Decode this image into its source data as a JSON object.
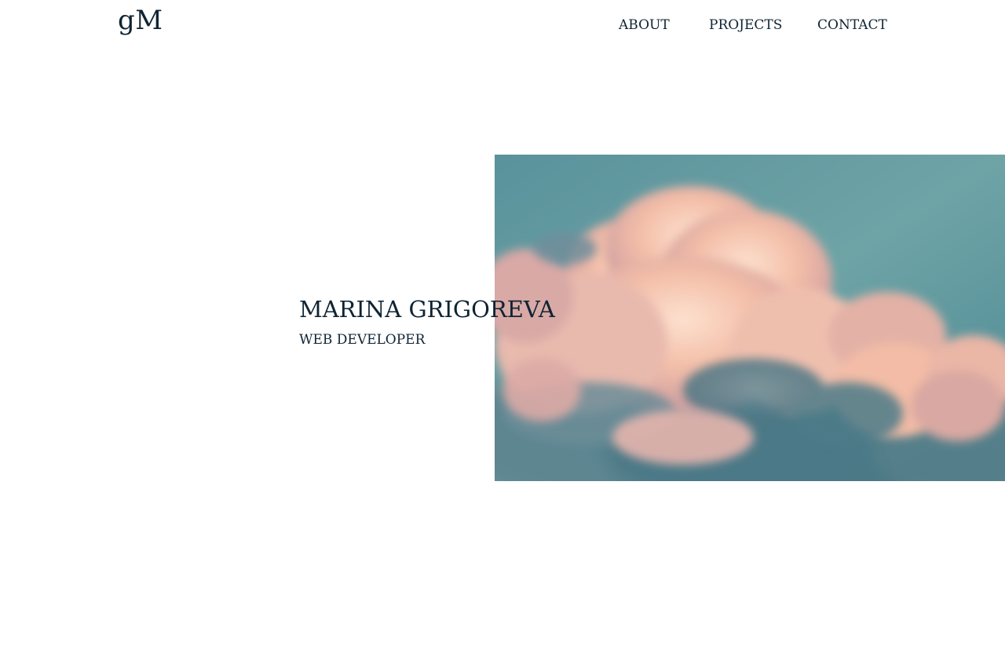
{
  "header": {
    "logo": "gM",
    "nav": [
      {
        "label": "ABOUT"
      },
      {
        "label": "PROJECTS"
      },
      {
        "label": "CONTACT"
      }
    ]
  },
  "hero": {
    "name": "MARINA GRIGOREVA",
    "role": "WEB DEVELOPER",
    "image": {
      "subject": "pink-tinted cumulus clouds against a teal sky"
    }
  },
  "colors": {
    "text": "#0f2433",
    "background": "#ffffff",
    "sky": "#5e96a0",
    "cloud_highlight": "#f5c2ad",
    "cloud_shadow": "#4d7d8a"
  }
}
